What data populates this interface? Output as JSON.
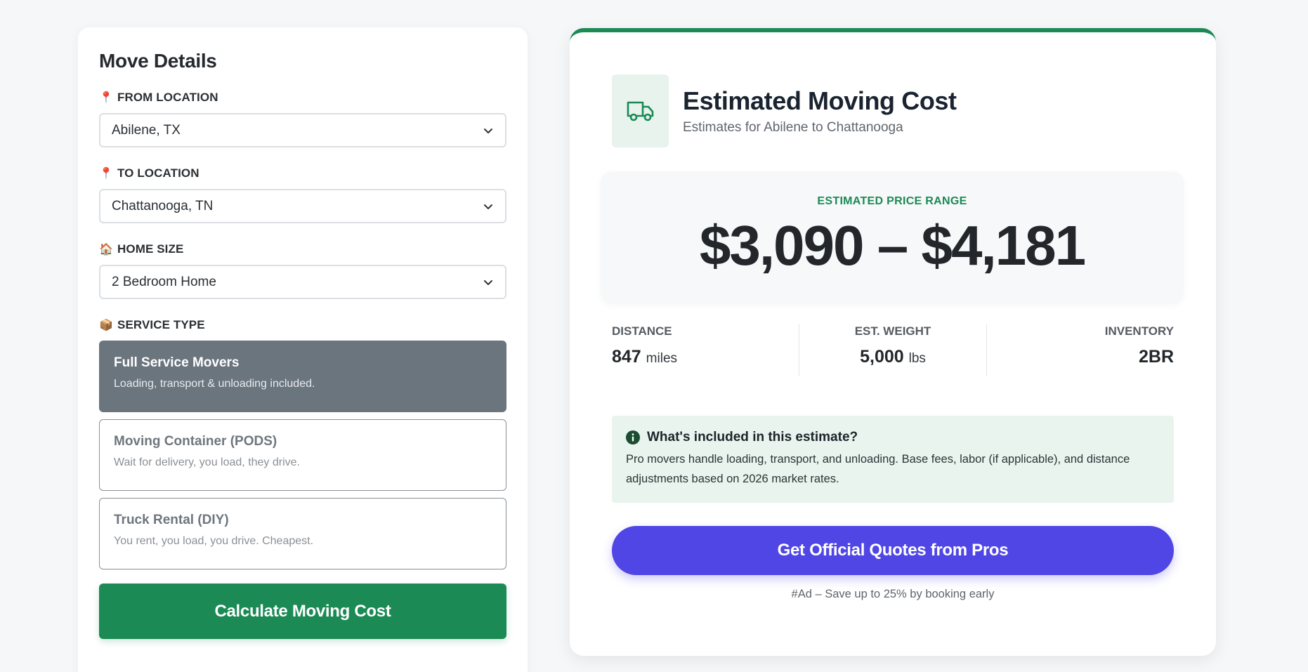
{
  "move_details": {
    "title": "Move Details",
    "from": {
      "icon": "📍",
      "label": "FROM LOCATION",
      "value": "Abilene, TX"
    },
    "to": {
      "icon": "📍",
      "label": "TO LOCATION",
      "value": "Chattanooga, TN"
    },
    "home_size": {
      "icon": "🏠",
      "label": "HOME SIZE",
      "value": "2 Bedroom Home"
    },
    "service_type": {
      "icon": "📦",
      "label": "SERVICE TYPE",
      "options": [
        {
          "title": "Full Service Movers",
          "desc": "Loading, transport & unloading included.",
          "selected": true
        },
        {
          "title": "Moving Container (PODS)",
          "desc": "Wait for delivery, you load, they drive.",
          "selected": false
        },
        {
          "title": "Truck Rental (DIY)",
          "desc": "You rent, you load, you drive. Cheapest.",
          "selected": false
        }
      ]
    },
    "calculate_label": "Calculate Moving Cost"
  },
  "result": {
    "title": "Estimated Moving Cost",
    "subtitle": "Estimates for Abilene to Chattanooga",
    "price_label": "ESTIMATED PRICE RANGE",
    "price_value": "$3,090 – $4,181",
    "stats": {
      "distance": {
        "label": "DISTANCE",
        "value": "847",
        "unit": "miles"
      },
      "weight": {
        "label": "EST. WEIGHT",
        "value": "5,000",
        "unit": "lbs"
      },
      "inventory": {
        "label": "INVENTORY",
        "value": "2BR"
      }
    },
    "info": {
      "title": "What's included in this estimate?",
      "body": "Pro movers handle loading, transport, and unloading. Base fees, labor (if applicable), and distance adjustments based on 2026 market rates."
    },
    "quote_button": "Get Official Quotes from Pros",
    "ad_note": "#Ad – Save up to 25% by booking early"
  },
  "colors": {
    "brand_green": "#1b8a55",
    "cta_indigo": "#4f46e5",
    "selected_service": "#6b757e",
    "info_bg": "#e8f4ed"
  },
  "icons": [
    "pin-icon",
    "house-icon",
    "package-icon",
    "chevron-down-icon",
    "truck-icon",
    "info-icon"
  ]
}
